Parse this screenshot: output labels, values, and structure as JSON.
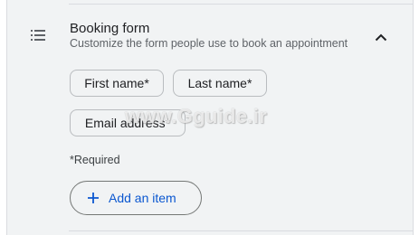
{
  "section": {
    "title": "Booking form",
    "subtitle": "Customize the form people use to book an appointment",
    "icon": "list-icon",
    "collapse_icon": "chevron-up-icon"
  },
  "fields": [
    {
      "label": "First name*"
    },
    {
      "label": "Last name*"
    },
    {
      "label": "Email address*"
    }
  ],
  "required_note": "*Required",
  "add_item": {
    "label": "Add an item",
    "icon": "plus-icon"
  },
  "watermark": "www.Gguide.ir",
  "colors": {
    "panel_bg": "#f1f3f4",
    "accent": "#0b57d0",
    "border": "#dadce0"
  }
}
